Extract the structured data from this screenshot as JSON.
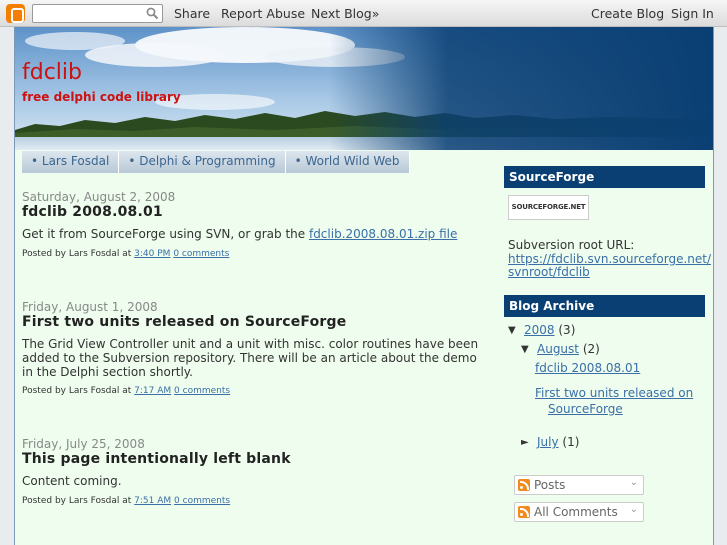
{
  "navbar": {
    "search_placeholder": "",
    "share": "Share",
    "report_abuse": "Report Abuse",
    "next_blog": "Next Blog»",
    "create_blog": "Create Blog",
    "sign_in": "Sign In"
  },
  "header": {
    "title": "fdclib",
    "description": "free delphi code library"
  },
  "tabs": [
    "• Lars Fosdal",
    "• Delphi & Programming",
    "• World Wild Web"
  ],
  "posts": [
    {
      "date": "Saturday, August 2, 2008",
      "title": "fdclib 2008.08.01",
      "body_prefix": "Get it from SourceForge using SVN, or grab the ",
      "body_link": "fdclib.2008.08.01.zip file",
      "posted_by": "Posted by Lars Fosdal at ",
      "time": "3:40 PM",
      "comments": "0 comments"
    },
    {
      "date": "Friday, August 1, 2008",
      "title": "First two units released on SourceForge",
      "body": "The Grid View Controller unit and a unit with misc. color routines have been added to the Subversion repository. There will be an article about the demo in the Delphi section shortly.",
      "posted_by": "Posted by Lars Fosdal at ",
      "time": "7:17 AM",
      "comments": "0 comments"
    },
    {
      "date": "Friday, July 25, 2008",
      "title": "This page intentionally left blank",
      "body": "Content coming.",
      "posted_by": "Posted by Lars Fosdal at ",
      "time": "7:51 AM",
      "comments": "0 comments"
    }
  ],
  "sidebar": {
    "sourceforge": {
      "title": "SourceForge",
      "logo_text": "SOURCEFORGE.NET",
      "svn_label": "Subversion root URL:",
      "svn_url_line1": "https://fdclib.svn.sourceforge.net/",
      "svn_url_line2": "svnroot/fdclib"
    },
    "archive": {
      "title": "Blog Archive",
      "year": "2008",
      "year_count": "(3)",
      "month1": "August",
      "month1_count": "(2)",
      "post1": "fdclib 2008.08.01",
      "post2_line1": "First two units released on",
      "post2_line2": "SourceForge",
      "month2": "July",
      "month2_count": "(1)",
      "expanded_arrow": "▼",
      "collapsed_arrow": "►"
    },
    "feeds": {
      "posts": "Posts",
      "comments": "All Comments"
    }
  },
  "colors": {
    "title_red": "#cc1111",
    "link_blue": "#3a6fa8",
    "widget_bar": "#0a3f73",
    "page_bg": "#eefded"
  }
}
